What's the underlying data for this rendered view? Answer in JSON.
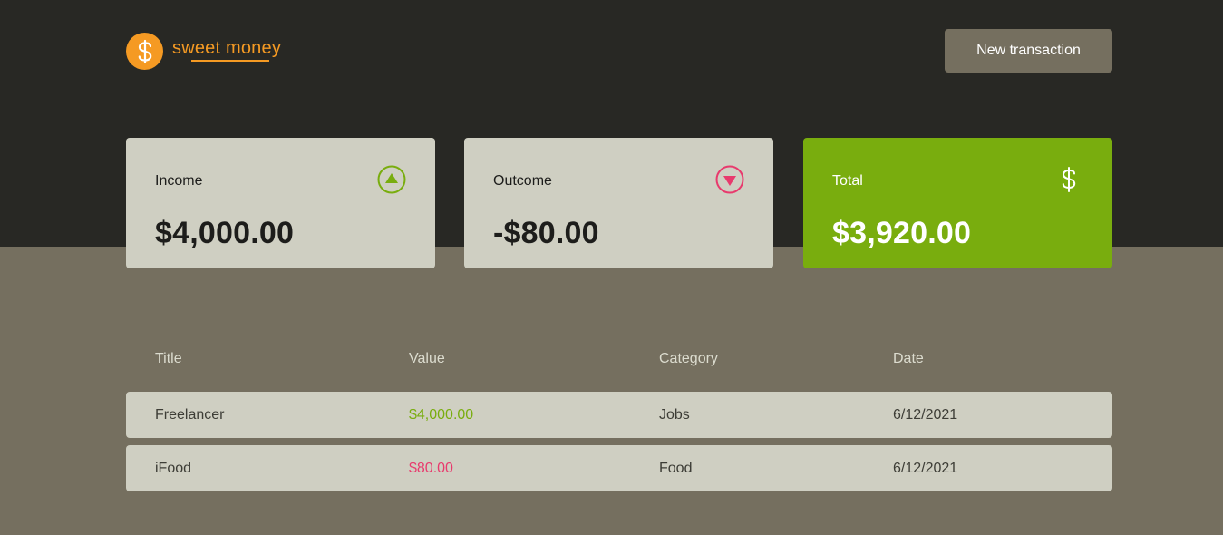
{
  "brand": {
    "name": "sweet money",
    "icon": "dollar-icon",
    "color": "#f59a23"
  },
  "header": {
    "new_transaction_label": "New transaction"
  },
  "summary": {
    "income": {
      "label": "Income",
      "value": "$4,000.00",
      "icon": "arrow-up-circle-icon"
    },
    "outcome": {
      "label": "Outcome",
      "value": "-$80.00",
      "icon": "arrow-down-circle-icon"
    },
    "total": {
      "label": "Total",
      "value": "$3,920.00",
      "icon": "dollar-icon"
    }
  },
  "table": {
    "columns": [
      "Title",
      "Value",
      "Category",
      "Date"
    ],
    "rows": [
      {
        "title": "Freelancer",
        "value": "$4,000.00",
        "type": "income",
        "category": "Jobs",
        "date": "6/12/2021"
      },
      {
        "title": "iFood",
        "value": "$80.00",
        "type": "outcome",
        "category": "Food",
        "date": "6/12/2021"
      }
    ]
  },
  "colors": {
    "header_bg": "#282824",
    "page_bg": "#756f5f",
    "card_bg": "#cfcfc2",
    "total_bg": "#79ad0e",
    "income": "#79ad0e",
    "outcome": "#e83a6d"
  }
}
